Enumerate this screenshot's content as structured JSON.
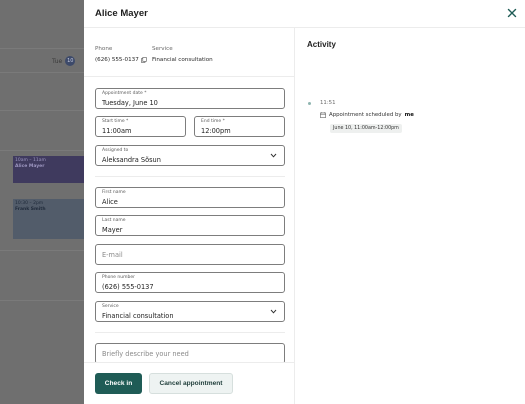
{
  "backdrop": {
    "day_label": "Tue",
    "day_number": "10",
    "appointments": [
      {
        "time": "10am – 11am",
        "name": "Alice Mayer"
      },
      {
        "time": "10:30 – 2pm",
        "name": "Frank Smith"
      }
    ]
  },
  "modal": {
    "title": "Alice Mayer",
    "info": {
      "phone_label": "Phone",
      "phone_value": "(626) 555-0137",
      "service_label": "Service",
      "service_value": "Financial consultation"
    },
    "form": {
      "appointment_date": {
        "label": "Appointment date *",
        "value": "Tuesday, June 10"
      },
      "start_time": {
        "label": "Start time *",
        "value": "11:00am"
      },
      "end_time": {
        "label": "End time *",
        "value": "12:00pm"
      },
      "assigned_to": {
        "label": "Assigned to",
        "value": "Aleksandra Sõsun"
      },
      "first_name": {
        "label": "First name",
        "value": "Alice"
      },
      "last_name": {
        "label": "Last name",
        "value": "Mayer"
      },
      "email": {
        "placeholder": "E-mail"
      },
      "phone_number": {
        "label": "Phone number",
        "value": "(626) 555-0137"
      },
      "service": {
        "label": "Service",
        "value": "Financial consultation"
      },
      "need": {
        "placeholder": "Briefly describe your need"
      }
    },
    "buttons": {
      "check_in": "Check in",
      "cancel": "Cancel appointment"
    },
    "activity": {
      "title": "Activity",
      "entries": [
        {
          "time": "11:51",
          "text": "Appointment scheduled by",
          "actor": "me",
          "detail": "June 10, 11:00am-12:00pm"
        }
      ]
    }
  },
  "colors": {
    "primary": "#1f5c56",
    "backdrop": "#6f6f6f",
    "secondary_bg": "#eef3f2"
  }
}
